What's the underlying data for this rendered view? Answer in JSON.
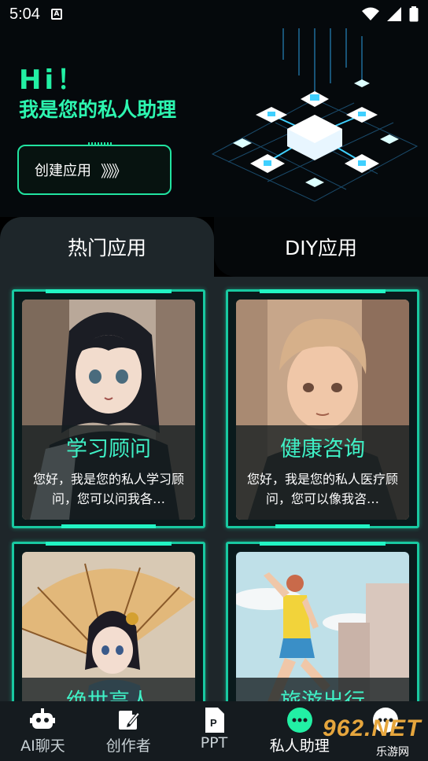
{
  "status_bar": {
    "time": "5:04"
  },
  "hero": {
    "greeting": "Hi！",
    "subtitle": "我是您的私人助理",
    "cta_label": "创建应用",
    "cta_chevrons": "》》》"
  },
  "tabs": [
    {
      "label": "热门应用",
      "active": true
    },
    {
      "label": "DIY应用",
      "active": false
    }
  ],
  "cards": [
    {
      "title": "学习顾问",
      "desc": "您好，我是您的私人学习顾问，您可以问我各…"
    },
    {
      "title": "健康咨询",
      "desc": "您好，我是您的私人医疗顾问，您可以像我咨…"
    },
    {
      "title": "绝世高人",
      "desc": ""
    },
    {
      "title": "旅游出行",
      "desc": ""
    }
  ],
  "nav": [
    {
      "label": "AI聊天",
      "icon": "robot-icon"
    },
    {
      "label": "创作者",
      "icon": "pen-note-icon"
    },
    {
      "label": "PPT",
      "icon": "ppt-file-icon"
    },
    {
      "label": "私人助理",
      "icon": "chat-bubble-icon",
      "active": true
    },
    {
      "label": "",
      "icon": "chat-bubble-icon"
    }
  ],
  "watermark": {
    "big": "962.NET",
    "small": "乐游网"
  },
  "colors": {
    "accent": "#22f0a4",
    "card_title": "#3ff1c6",
    "background": "#1e262a"
  }
}
